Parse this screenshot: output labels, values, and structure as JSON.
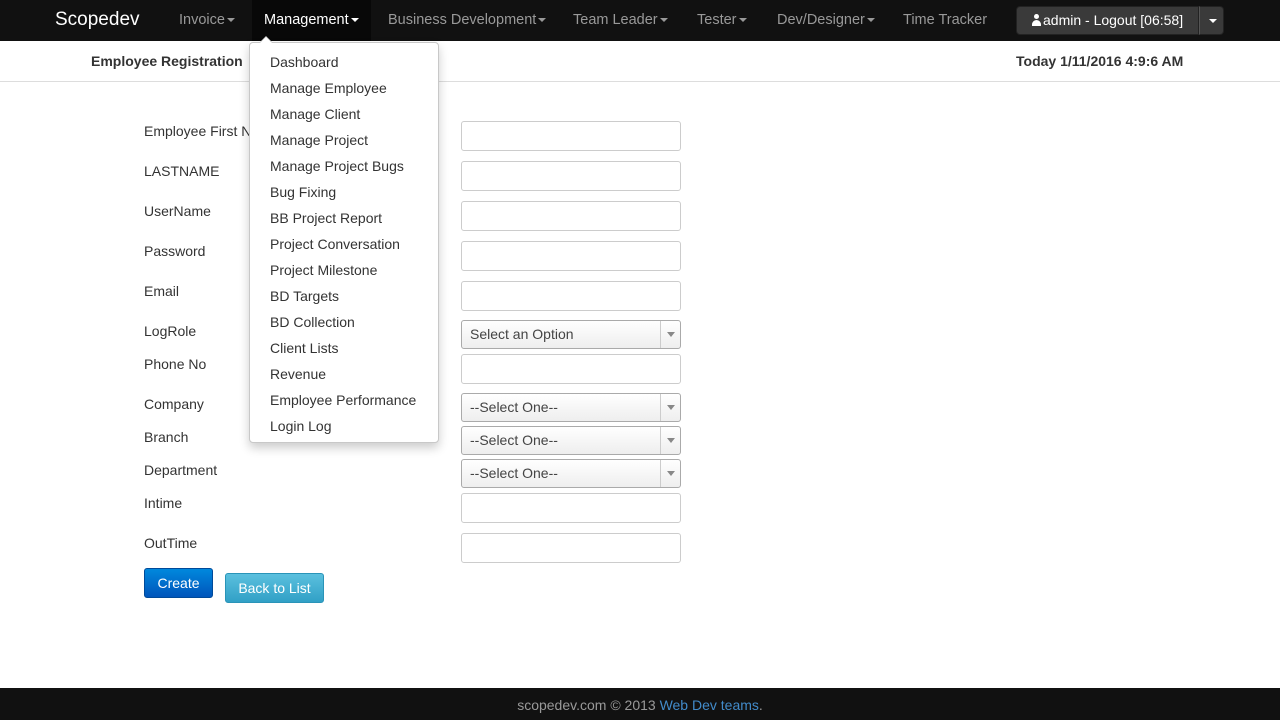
{
  "navbar": {
    "brand": "Scopedev",
    "items": [
      {
        "label": "Invoice",
        "dropdown": true
      },
      {
        "label": "Management",
        "dropdown": true,
        "active": true
      },
      {
        "label": "Business Development",
        "dropdown": true
      },
      {
        "label": "Team Leader",
        "dropdown": true
      },
      {
        "label": "Tester",
        "dropdown": true
      },
      {
        "label": "Dev/Designer",
        "dropdown": true
      },
      {
        "label": "Time Tracker",
        "dropdown": false
      }
    ],
    "user_button": "admin - Logout [06:58]"
  },
  "subheader": {
    "title": "Employee Registration",
    "today": "Today 1/11/2016 4:9:6 AM"
  },
  "form": {
    "labels": {
      "first_name": "Employee First Name",
      "last_name": "LASTNAME",
      "username": "UserName",
      "password": "Password",
      "email": "Email",
      "logrole": "LogRole",
      "phone": "Phone No",
      "company": "Company",
      "branch": "Branch",
      "department": "Department",
      "intime": "Intime",
      "outtime": "OutTime"
    },
    "logrole_select": "Select an Option",
    "company_select": "--Select One--",
    "branch_select": "--Select One--",
    "department_select": "--Select One--",
    "create_label": "Create",
    "back_label": "Back to List"
  },
  "management_menu": [
    "Dashboard",
    "Manage Employee",
    "Manage Client",
    "Manage Project",
    "Manage Project Bugs",
    "Bug Fixing",
    "BB Project Report",
    "Project Conversation",
    "Project Milestone",
    "BD Targets",
    "BD Collection",
    "Client Lists",
    "Revenue",
    "Employee Performance",
    "Login Log"
  ],
  "footer": {
    "text": "scopedev.com © 2013",
    "link": "Web Dev teams",
    "suffix": "."
  }
}
